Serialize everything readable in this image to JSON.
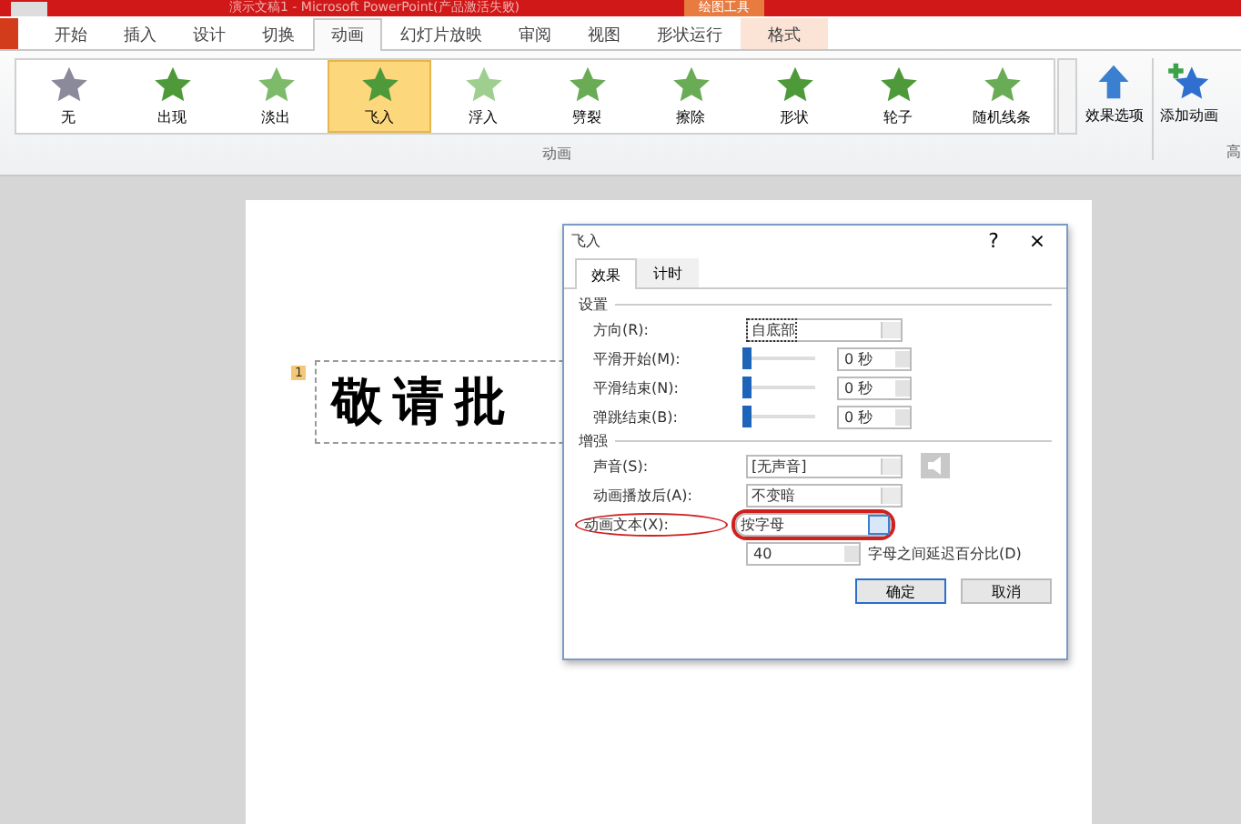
{
  "window": {
    "title": "演示文稿1 - Microsoft PowerPoint(产品激活失败)",
    "context_tab": "绘图工具"
  },
  "tabs": [
    {
      "label": "开始",
      "selected": false
    },
    {
      "label": "插入",
      "selected": false
    },
    {
      "label": "设计",
      "selected": false
    },
    {
      "label": "切换",
      "selected": false
    },
    {
      "label": "动画",
      "selected": true
    },
    {
      "label": "幻灯片放映",
      "selected": false
    },
    {
      "label": "审阅",
      "selected": false
    },
    {
      "label": "视图",
      "selected": false
    },
    {
      "label": "形状运行",
      "selected": false
    },
    {
      "label": "格式",
      "selected": false,
      "kind": "context"
    }
  ],
  "gallery": {
    "group_label": "动画",
    "items": [
      {
        "label": "无",
        "selected": false,
        "color": "#8a8a9a"
      },
      {
        "label": "出现",
        "selected": false,
        "color": "#4e9a3a"
      },
      {
        "label": "淡出",
        "selected": false,
        "color": "#7dbb6a"
      },
      {
        "label": "飞入",
        "selected": true,
        "color": "#4e9a3a"
      },
      {
        "label": "浮入",
        "selected": false,
        "color": "#9fcf8e"
      },
      {
        "label": "劈裂",
        "selected": false,
        "color": "#6aab55"
      },
      {
        "label": "擦除",
        "selected": false,
        "color": "#6aab55"
      },
      {
        "label": "形状",
        "selected": false,
        "color": "#4e9a3a"
      },
      {
        "label": "轮子",
        "selected": false,
        "color": "#4e9a3a"
      },
      {
        "label": "随机线条",
        "selected": false,
        "color": "#6aab55"
      }
    ]
  },
  "ribbon_buttons": [
    {
      "label": "效果选项"
    },
    {
      "label": "添加动画"
    }
  ],
  "ribbon_cut_label": "高",
  "slide": {
    "text": "敬请批",
    "tag": "1"
  },
  "dialog": {
    "title": "飞入",
    "help": "?",
    "close": "×",
    "tabs": [
      {
        "label": "效果",
        "selected": true
      },
      {
        "label": "计时",
        "selected": false
      }
    ],
    "settings": {
      "heading": "设置",
      "direction": {
        "label": "方向(R):",
        "value": "自底部"
      },
      "sliders": [
        {
          "label": "平滑开始(M):",
          "level": 0,
          "value": "0 秒"
        },
        {
          "label": "平滑结束(N):",
          "level": 0,
          "value": "0 秒"
        },
        {
          "label": "弹跳结束(B):",
          "level": 0,
          "value": "0 秒"
        }
      ]
    },
    "enhance": {
      "heading": "增强",
      "rows": [
        {
          "label": "声音(S):",
          "value": "[无声音]",
          "circled": false,
          "sound_button": true
        },
        {
          "label": "动画播放后(A):",
          "value": "不变暗",
          "circled": false,
          "sound_button": false
        },
        {
          "label": "动画文本(X):",
          "value": "按字母",
          "circled": true,
          "sound_button": false
        }
      ],
      "delay": {
        "value": "40",
        "label": "字母之间延迟百分比(D)"
      }
    },
    "buttons": [
      {
        "label": "确定",
        "primary": true
      },
      {
        "label": "取消",
        "primary": false
      }
    ]
  }
}
